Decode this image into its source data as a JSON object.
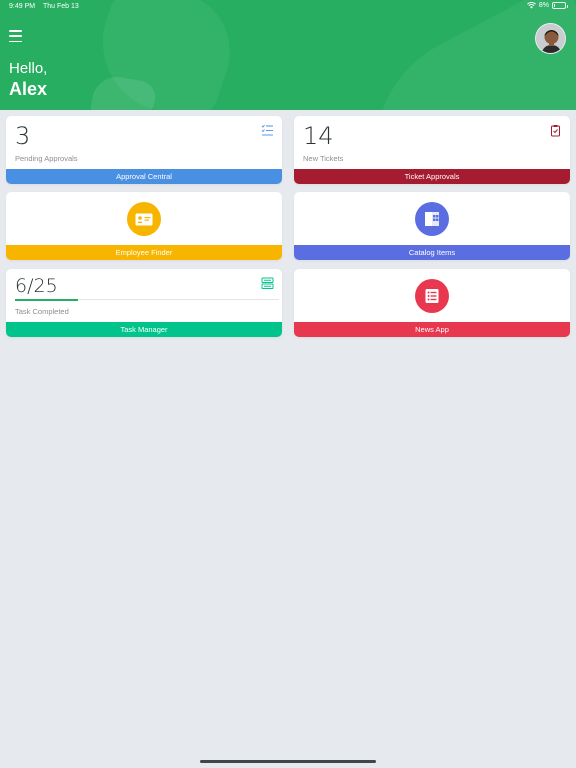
{
  "status_bar": {
    "time": "9:49 PM",
    "date": "Thu Feb 13",
    "battery": "8%",
    "battery_level": 0.08
  },
  "header": {
    "greeting": "Hello,",
    "user_name": "Alex",
    "background_color": "#27ae60"
  },
  "cards": {
    "approval_central": {
      "count": "3",
      "subtitle": "Pending Approvals",
      "footer_label": "Approval Central",
      "color": "#4a90e2",
      "icon": "checklist-icon"
    },
    "ticket_approvals": {
      "count": "14",
      "subtitle": "New Tickets",
      "footer_label": "Ticket Approvals",
      "color": "#a51c30",
      "icon": "clipboard-check-icon"
    },
    "employee_finder": {
      "footer_label": "Employee Finder",
      "color": "#f7b500",
      "icon": "id-card-icon"
    },
    "catalog_items": {
      "footer_label": "Catalog Items",
      "color": "#5b6ee1",
      "icon": "catalog-book-icon"
    },
    "task_manager": {
      "count": "6/25",
      "subtitle": "Task Completed",
      "footer_label": "Task Manager",
      "color": "#00c48c",
      "icon": "task-list-icon",
      "progress": 0.24
    },
    "news_app": {
      "footer_label": "News App",
      "color": "#e8384f",
      "icon": "news-list-icon"
    }
  }
}
